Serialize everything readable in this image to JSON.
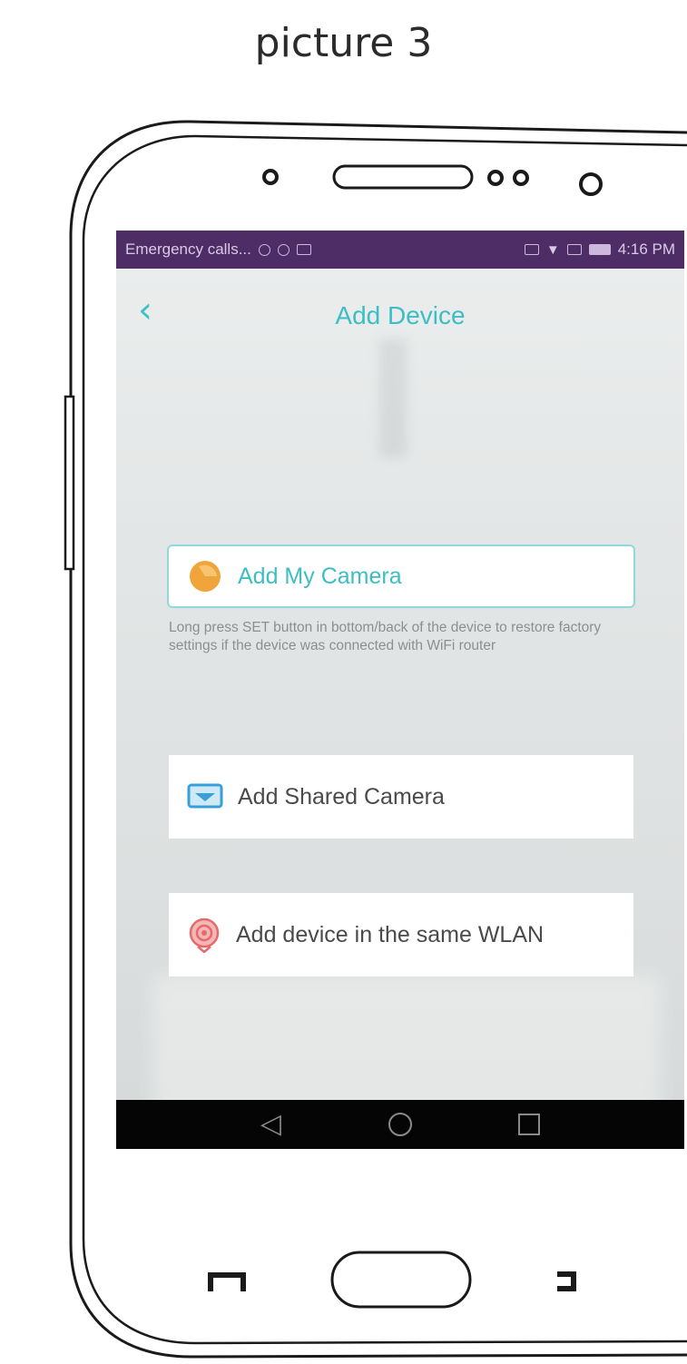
{
  "caption": "picture 3",
  "status_bar": {
    "left_text": "Emergency calls...",
    "time": "4:16 PM"
  },
  "header": {
    "title": "Add Device",
    "back_icon": "chevron-left-icon"
  },
  "options": [
    {
      "label": "Add My Camera",
      "icon": "camera-icon",
      "selected": true
    },
    {
      "label": "Add Shared Camera",
      "icon": "shared-screen-icon"
    },
    {
      "label": "Add device in the same WLAN",
      "icon": "wlan-icon"
    }
  ],
  "hint": "Long press SET button in bottom/back of the device to restore factory settings if the device was connected with WiFi router",
  "nav": {
    "back_icon": "triangle-back-icon",
    "home_icon": "circle-home-icon",
    "recents_icon": "square-recents-icon"
  },
  "colors": {
    "accent": "#3dbdc4",
    "status_bar": "#4e2c66",
    "nav_bar": "#050505",
    "camera_icon": "#f0a53a",
    "shared_icon": "#3a9fd8",
    "wlan_icon": "#e66a6a"
  }
}
